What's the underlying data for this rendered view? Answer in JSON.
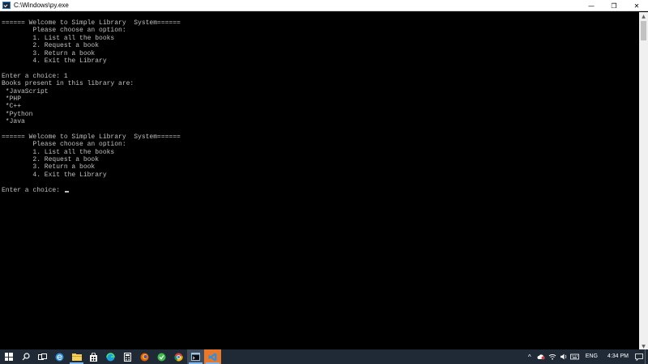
{
  "window": {
    "title": "C:\\Windows\\py.exe",
    "minimize_glyph": "—",
    "maximize_glyph": "❐",
    "close_glyph": "✕"
  },
  "console": {
    "lines": [
      "====== Welcome to Simple Library  System======",
      "        Please choose an option:",
      "        1. List all the books",
      "        2. Request a book",
      "        3. Return a book",
      "        4. Exit the Library",
      "",
      "Enter a choice: 1",
      "Books present in this library are:",
      " *JavaScript",
      " *PHP",
      " *C++",
      " *Python",
      " *Java",
      "",
      "====== Welcome to Simple Library  System======",
      "        Please choose an option:",
      "        1. List all the books",
      "        2. Request a book",
      "        3. Return a book",
      "        4. Exit the Library",
      "",
      "Enter a choice: "
    ],
    "text_color": "#c0c0c0",
    "background": "#000000"
  },
  "scrollbar": {
    "up_glyph": "▲",
    "down_glyph": "▼"
  },
  "taskbar": {
    "apps": [
      {
        "name": "search",
        "glyph": "⚲"
      },
      {
        "name": "task-view",
        "glyph": "▭"
      },
      {
        "name": "edge",
        "glyph": "e"
      },
      {
        "name": "file-explorer",
        "glyph": "▬"
      },
      {
        "name": "store",
        "glyph": "🛍"
      },
      {
        "name": "edge-chromium",
        "glyph": "◐"
      },
      {
        "name": "calculator",
        "glyph": "▦"
      },
      {
        "name": "firefox",
        "glyph": "◉"
      },
      {
        "name": "app-green",
        "glyph": "●"
      },
      {
        "name": "chrome",
        "glyph": "◎"
      },
      {
        "name": "python-console",
        "glyph": "▣"
      },
      {
        "name": "vscode",
        "glyph": "◢"
      }
    ],
    "tray": {
      "chevron": "^",
      "language": "ENG",
      "time": "4:34 PM"
    },
    "colors": {
      "background": "#1f2a36",
      "active_underline": "#7eb4ea",
      "vscode_accent": "#e8792b"
    }
  }
}
